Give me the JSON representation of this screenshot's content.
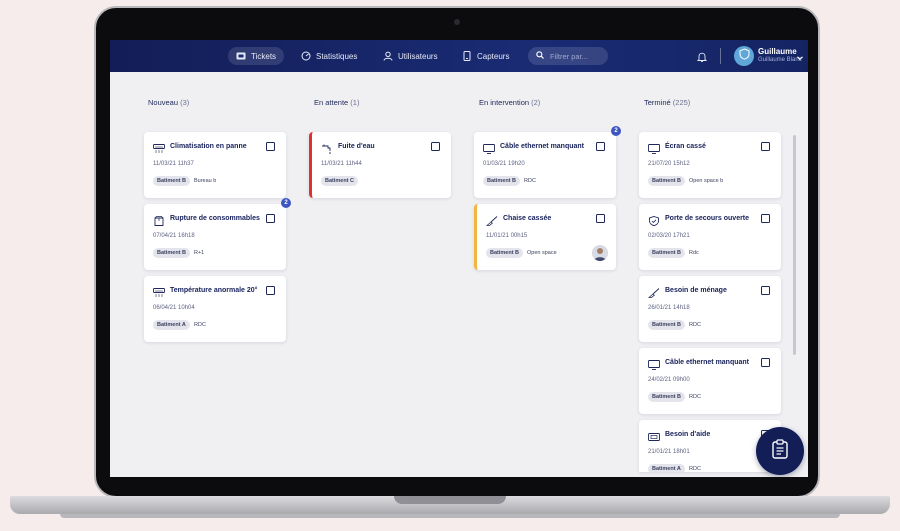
{
  "nav": {
    "items": [
      {
        "label": "Tickets",
        "icon": "ticket-icon",
        "active": true
      },
      {
        "label": "Statistiques",
        "icon": "gauge-icon",
        "active": false
      },
      {
        "label": "Utilisateurs",
        "icon": "user-icon",
        "active": false
      },
      {
        "label": "Capteurs",
        "icon": "sensor-icon",
        "active": false
      }
    ],
    "search_placeholder": "Filtrer par...",
    "user": {
      "name": "Guillaume",
      "full_name": "Guillaume Blanc"
    }
  },
  "columns": [
    {
      "title": "Nouveau",
      "count": "(3)",
      "cards": [
        {
          "icon": "air-conditioner-icon",
          "title": "Climatisation en panne",
          "date": "11/03/21 11h37",
          "tag": "Batiment B",
          "location": "Bureau b",
          "badge": "",
          "accent": ""
        },
        {
          "icon": "box-icon",
          "title": "Rupture de consommables",
          "date": "07/04/21 16h18",
          "tag": "Batiment B",
          "location": "R+1",
          "badge": "2",
          "accent": ""
        },
        {
          "icon": "air-conditioner-icon",
          "title": "Température anormale 20°",
          "date": "06/04/21 10h04",
          "tag": "Batiment A",
          "location": "RDC",
          "badge": "",
          "accent": ""
        }
      ]
    },
    {
      "title": "En attente",
      "count": "(1)",
      "cards": [
        {
          "icon": "faucet-icon",
          "title": "Fuite d'eau",
          "date": "11/03/21 11h44",
          "tag": "Batiment C",
          "location": "",
          "badge": "",
          "accent": "red"
        }
      ]
    },
    {
      "title": "En intervention",
      "count": "(2)",
      "cards": [
        {
          "icon": "monitor-icon",
          "title": "Câble ethernet manquant",
          "date": "01/03/21 19h20",
          "tag": "Batiment B",
          "location": "RDC",
          "badge": "2",
          "accent": ""
        },
        {
          "icon": "broom-icon",
          "title": "Chaise cassée",
          "date": "11/01/21 00h15",
          "tag": "Batiment B",
          "location": "Open space",
          "badge": "",
          "accent": "yellow",
          "assignee": true
        }
      ]
    },
    {
      "title": "Terminé",
      "count": "(225)",
      "cards": [
        {
          "icon": "monitor-icon",
          "title": "Écran cassé",
          "date": "21/07/20 15h12",
          "tag": "Batiment B",
          "location": "Open space b",
          "badge": "",
          "accent": ""
        },
        {
          "icon": "shield-icon",
          "title": "Porte de secours ouverte",
          "date": "02/03/20 17h21",
          "tag": "Batiment B",
          "location": "Rdc",
          "badge": "",
          "accent": ""
        },
        {
          "icon": "broom-icon",
          "title": "Besoin de ménage",
          "date": "26/01/21 14h18",
          "tag": "Batiment B",
          "location": "RDC",
          "badge": "",
          "accent": ""
        },
        {
          "icon": "monitor-icon",
          "title": "Câble ethernet manquant",
          "date": "24/02/21 09h00",
          "tag": "Batiment B",
          "location": "RDC",
          "badge": "",
          "accent": ""
        },
        {
          "icon": "help-desk-icon",
          "title": "Besoin d'aide",
          "date": "21/01/21 18h01",
          "tag": "Batiment A",
          "location": "RDC",
          "badge": "",
          "accent": ""
        }
      ]
    }
  ],
  "fab": {
    "icon": "clipboard-icon"
  },
  "colors": {
    "navbar": "#131e57",
    "accent_red": "#e0302f",
    "accent_yellow": "#f2b640",
    "badge": "#3e56c2"
  }
}
